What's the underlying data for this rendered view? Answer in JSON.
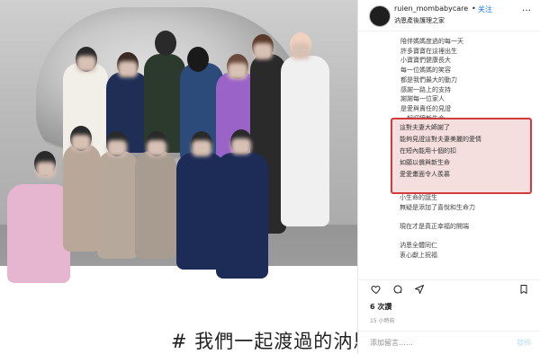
{
  "post": {
    "author": "ruien_mombabycare",
    "separator": "•",
    "follow_label": "关注",
    "location": "汭恩產後護理之家",
    "more": "…",
    "caption_lines": [
      "陪伴媽媽度過的每一天",
      "許多寶寶在這裡出生",
      "小寶寶們健康長大",
      "每一位媽媽的笑容",
      "都是我們最大的動力",
      "感謝一路上的支持",
      "謝謝每一位家人",
      "是愛與責任的見證",
      "一起迎接新生命"
    ],
    "highlight_lines": [
      "這對夫妻大師謝了",
      "能夠見證這對夫妻美麗的愛情",
      "在短內能用十個的扣",
      "如願以償與新生命",
      "愛愛畫面令人羨慕"
    ],
    "after_lines": [
      "小生命的誕生",
      "無疑是添加了喜悅和生命力",
      "",
      "現在才是真正幸福的開端",
      "",
      "汭恩全體同仁",
      "衷心獻上祝福"
    ],
    "likes": "6 次讚",
    "time": "15 小時前",
    "comment_placeholder": "添加留言……",
    "post_label": "發佈"
  },
  "photo": {
    "caption": "# 我們一起渡過的汭恩時"
  },
  "colors": {
    "highlight_border": "#d23b3b",
    "highlight_fill": "#f5dede",
    "link_blue": "#1877f2"
  },
  "icons": [
    "heart-icon",
    "comment-icon",
    "share-icon",
    "bookmark-icon"
  ]
}
